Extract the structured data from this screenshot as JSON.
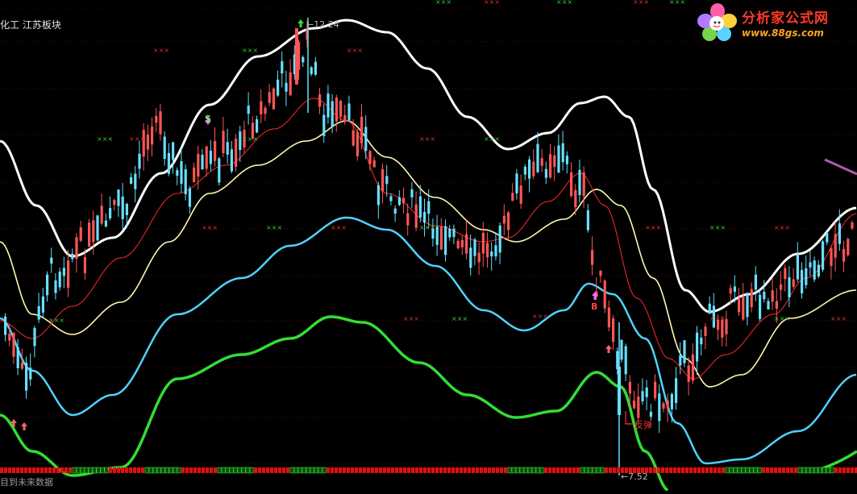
{
  "window": {
    "title": "化工 江苏板块",
    "footer_text": "目到未来数据"
  },
  "logo": {
    "name": "分析家公式网",
    "url": "www.88gs.com",
    "colors": {
      "name": "#ff3a2a",
      "url": "#ffa51f"
    }
  },
  "chart_data": {
    "type": "candlestick",
    "title": "",
    "xlabel": "",
    "ylabel": "",
    "grid": true,
    "colors": {
      "up": "#ff5555",
      "down": "#66e0ff",
      "band_outer": "#ffffff",
      "band_mid": "#fff7b0",
      "band_lower": "#4fd3ff",
      "band_bottom": "#33dd33",
      "ma_red": "#ff2a2a",
      "purple": "#b05ab0"
    },
    "annotations": {
      "high_label": "12.24",
      "low_label": "7.52",
      "rebound_label": "反弹",
      "sell_marker": "S",
      "buy_marker": "B"
    }
  }
}
